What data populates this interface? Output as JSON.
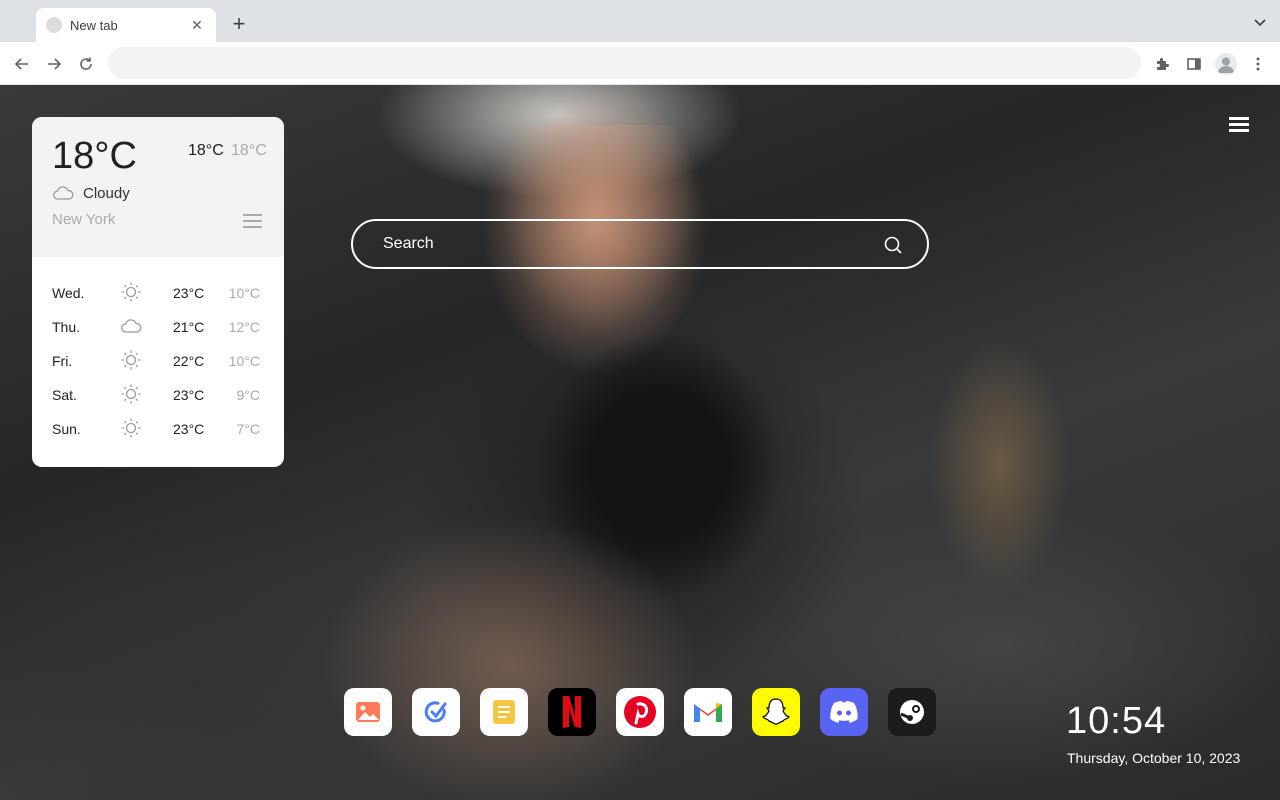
{
  "browser": {
    "tab_title": "New tab",
    "address_value": "",
    "address_placeholder": ""
  },
  "weather": {
    "current_temp": "18°C",
    "high": "18°C",
    "low": "18°C",
    "condition": "Cloudy",
    "condition_icon": "cloud-icon",
    "city": "New York",
    "forecast": [
      {
        "day": "Wed.",
        "icon": "sun-icon",
        "high": "23°C",
        "low": "10°C"
      },
      {
        "day": "Thu.",
        "icon": "cloud-icon",
        "high": "21°C",
        "low": "12°C"
      },
      {
        "day": "Fri.",
        "icon": "sun-icon",
        "high": "22°C",
        "low": "10°C"
      },
      {
        "day": "Sat.",
        "icon": "sun-icon",
        "high": "23°C",
        "low": "9°C"
      },
      {
        "day": "Sun.",
        "icon": "sun-icon",
        "high": "23°C",
        "low": "7°C"
      }
    ]
  },
  "search": {
    "placeholder": "Search"
  },
  "dock": [
    {
      "name": "photos",
      "icon": "image-icon",
      "bg": "#ffffff"
    },
    {
      "name": "tasks",
      "icon": "check-circle-icon",
      "bg": "#ffffff"
    },
    {
      "name": "notes",
      "icon": "note-icon",
      "bg": "#ffffff"
    },
    {
      "name": "netflix",
      "icon": "netflix-icon",
      "bg": "#000000"
    },
    {
      "name": "pinterest",
      "icon": "pinterest-icon",
      "bg": "#ffffff"
    },
    {
      "name": "gmail",
      "icon": "gmail-icon",
      "bg": "#ffffff"
    },
    {
      "name": "snapchat",
      "icon": "snapchat-icon",
      "bg": "#fffc00"
    },
    {
      "name": "discord",
      "icon": "discord-icon",
      "bg": "#5865f2"
    },
    {
      "name": "steam",
      "icon": "steam-icon",
      "bg": "#1b1b1b"
    }
  ],
  "clock": {
    "time": "10:54",
    "date": "Thursday, October 10, 2023"
  }
}
